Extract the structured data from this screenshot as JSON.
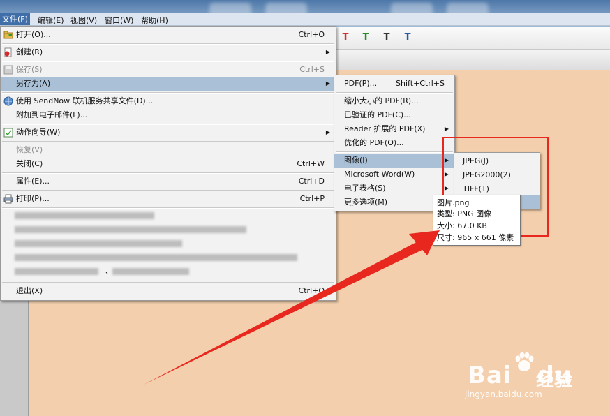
{
  "menubar": {
    "file": "文件(F)",
    "edit": "编辑(E)",
    "view": "视图(V)",
    "window": "窗口(W)",
    "help": "帮助(H)"
  },
  "file_menu": {
    "open": {
      "label": "打开(O)...",
      "shortcut": "Ctrl+O"
    },
    "create": {
      "label": "创建(R)"
    },
    "save": {
      "label": "保存(S)",
      "shortcut": "Ctrl+S"
    },
    "save_as": {
      "label": "另存为(A)"
    },
    "sendnow": {
      "label": "使用 SendNow 联机服务共享文件(D)..."
    },
    "attach_email": {
      "label": "附加到电子邮件(L)..."
    },
    "action_wizard": {
      "label": "动作向导(W)"
    },
    "revert": {
      "label": "恢复(V)"
    },
    "close": {
      "label": "关闭(C)",
      "shortcut": "Ctrl+W"
    },
    "properties": {
      "label": "属性(E)...",
      "shortcut": "Ctrl+D"
    },
    "print": {
      "label": "打印(P)...",
      "shortcut": "Ctrl+P"
    },
    "recent_stub": "、",
    "exit": {
      "label": "退出(X)",
      "shortcut": "Ctrl+Q"
    }
  },
  "save_as_menu": {
    "pdf": {
      "label": "PDF(P)...",
      "shortcut": "Shift+Ctrl+S"
    },
    "reduced_pdf": {
      "label": "缩小大小的 PDF(R)..."
    },
    "certified_pdf": {
      "label": "已验证的 PDF(C)..."
    },
    "reader_pdf": {
      "label": "Reader 扩展的 PDF(X)"
    },
    "optimized_pdf": {
      "label": "优化的 PDF(O)..."
    },
    "image": {
      "label": "图像(I)"
    },
    "word": {
      "label": "Microsoft Word(W)"
    },
    "spreadsheet": {
      "label": "电子表格(S)"
    },
    "more": {
      "label": "更多选项(M)"
    }
  },
  "image_menu": {
    "jpeg": "JPEG(J)",
    "jpeg2000": "JPEG2000(2)",
    "tiff": "TIFF(T)"
  },
  "tooltip": {
    "name": "图片.png",
    "type": "类型: PNG 图像",
    "size": "大小: 67.0 KB",
    "dimensions": "尺寸: 965 x 661 像素"
  },
  "watermark": {
    "brand": "Bai",
    "brand2": "du",
    "jingyan": "经验",
    "url": "jingyan.baidu.com"
  },
  "colors": {
    "highlight": "#a9c0d6",
    "annotation_red": "#e8281e",
    "document_bg": "#f3cfad"
  }
}
